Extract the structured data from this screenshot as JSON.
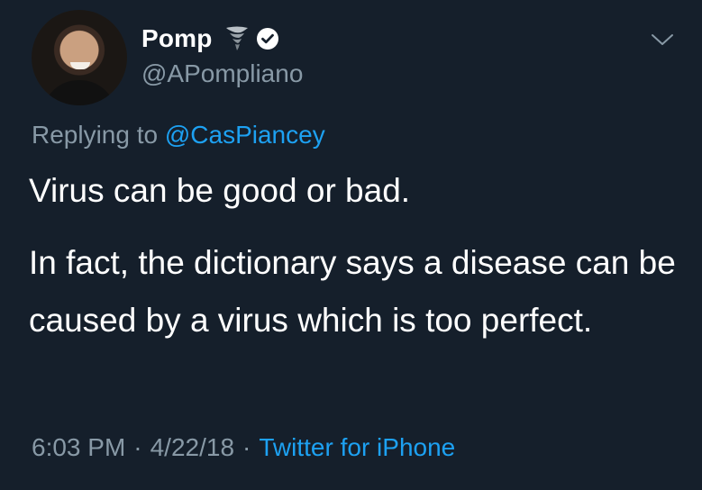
{
  "author": {
    "display_name": "Pomp",
    "handle": "@APompliano",
    "avatar_icon": "profile-photo",
    "badges": [
      "tornado-emoji-icon",
      "verified-icon"
    ]
  },
  "reply": {
    "prefix": "Replying to",
    "mention": "@CasPiancey"
  },
  "tweet": {
    "paragraph1": "Virus can be good or bad.",
    "paragraph2": "In fact, the dictionary says a disease can be caused by a virus which is too perfect."
  },
  "meta": {
    "time": "6:03 PM",
    "separator": "·",
    "date": "4/22/18",
    "source": "Twitter for iPhone"
  },
  "colors": {
    "background": "#151f2b",
    "text": "#ffffff",
    "secondary": "#8899a6",
    "accent": "#1da1f2"
  }
}
